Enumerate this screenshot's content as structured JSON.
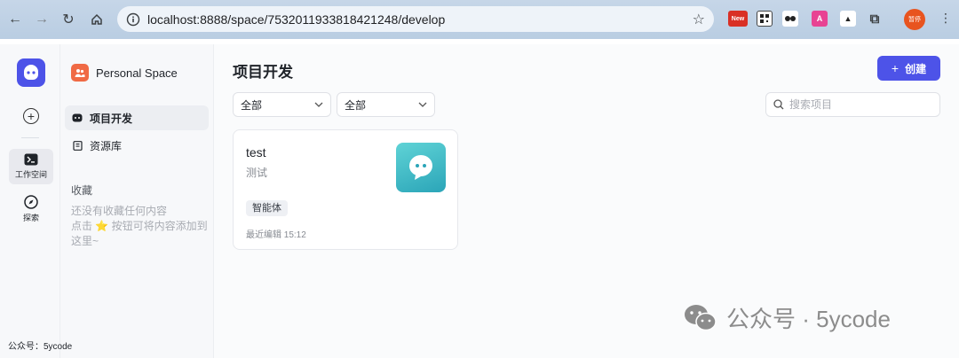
{
  "browser": {
    "url": "localhost:8888/space/7532011933818421248/develop",
    "extension_badge": "New",
    "profile_label": "暂停"
  },
  "rail": {
    "items": [
      {
        "label": "工作空间",
        "active": true
      },
      {
        "label": "探索",
        "active": false
      }
    ]
  },
  "sidebar": {
    "space_name": "Personal Space",
    "items": [
      {
        "label": "项目开发",
        "active": true
      },
      {
        "label": "资源库",
        "active": false
      }
    ],
    "favorites_title": "收藏",
    "favorites_empty_line1": "还没有收藏任何内容",
    "favorites_empty_line2": "点击 ⭐ 按钮可将内容添加到这里~"
  },
  "main": {
    "title": "项目开发",
    "create_label": "创建",
    "filter1": "全部",
    "filter2": "全部",
    "search_placeholder": "搜索项目",
    "projects": [
      {
        "name": "test",
        "description": "测试",
        "tag": "智能体",
        "meta": "最近编辑 15:12"
      }
    ]
  },
  "watermark": {
    "text": "公众号 · 5ycode"
  },
  "corner_text": "公众号：5ycode",
  "colors": {
    "accent": "#4d53e8",
    "space_avatar": "#f06a45"
  }
}
